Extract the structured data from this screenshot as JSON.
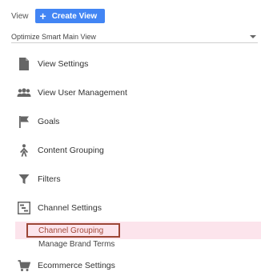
{
  "header": {
    "view_label": "View",
    "create_view_label": "Create View",
    "view_selector_value": "Optimize Smart Main View"
  },
  "nav": {
    "items": [
      {
        "label": "View Settings",
        "icon": "document-icon"
      },
      {
        "label": "View User Management",
        "icon": "users-icon"
      },
      {
        "label": "Goals",
        "icon": "flag-icon"
      },
      {
        "label": "Content Grouping",
        "icon": "person-walking-icon"
      },
      {
        "label": "Filters",
        "icon": "filter-icon"
      },
      {
        "label": "Channel Settings",
        "icon": "channel-settings-icon"
      },
      {
        "label": "Ecommerce Settings",
        "icon": "cart-icon"
      }
    ],
    "channel_sub_items": [
      {
        "label": "Channel Grouping",
        "active": true
      },
      {
        "label": "Manage Brand Terms",
        "active": false
      }
    ]
  },
  "colors": {
    "primary_button": "#4285f4",
    "active_sub_highlight": "#fce4ec",
    "active_sub_border": "#9c4636",
    "active_sub_text": "#a2493a",
    "icon_color": "#666666"
  }
}
